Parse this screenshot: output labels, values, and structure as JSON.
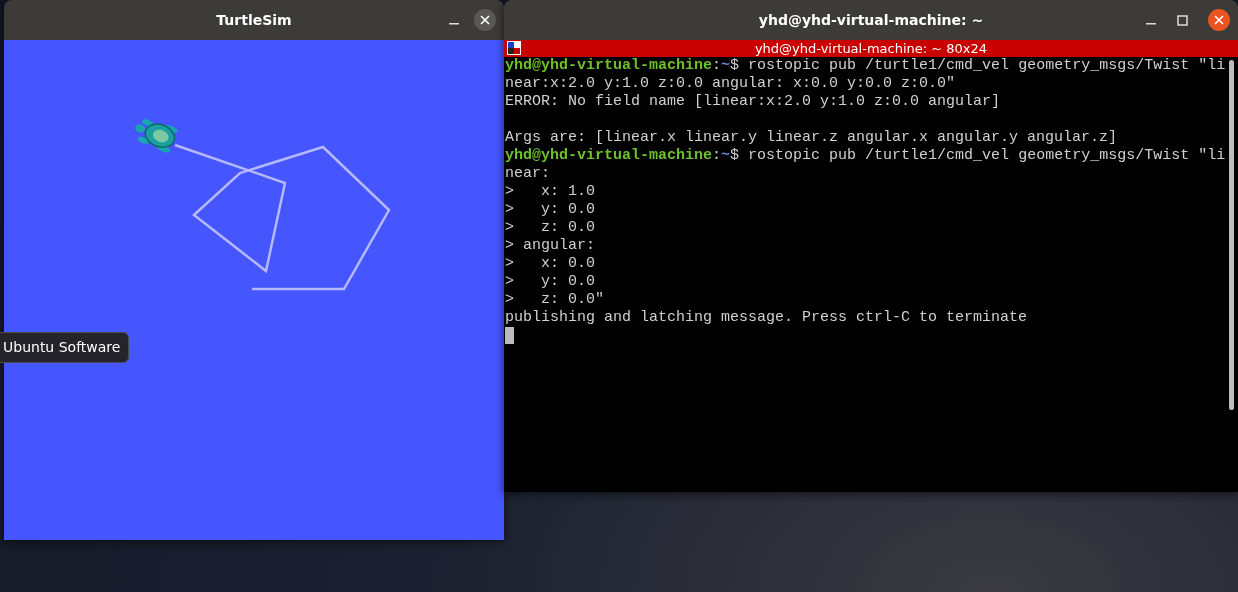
{
  "turtlesim": {
    "title": "TurtleSim"
  },
  "terminal": {
    "title": "yhd@yhd-virtual-machine: ~",
    "tab_title": "yhd@yhd-virtual-machine: ~ 80x24",
    "lines": [
      {
        "kind": "prompt",
        "user": "yhd@yhd-virtual-machine",
        "sep": ":",
        "path": "~",
        "command": "$ rostopic pub /turtle1/cmd_vel geometry_msgs/Twist \"li"
      },
      {
        "kind": "output",
        "text": "near:x:2.0 y:1.0 z:0.0 angular: x:0.0 y:0.0 z:0.0\""
      },
      {
        "kind": "output",
        "text": "ERROR: No field name [linear:x:2.0 y:1.0 z:0.0 angular]"
      },
      {
        "kind": "blank"
      },
      {
        "kind": "output",
        "text": "Args are: [linear.x linear.y linear.z angular.x angular.y angular.z]"
      },
      {
        "kind": "prompt",
        "user": "yhd@yhd-virtual-machine",
        "sep": ":",
        "path": "~",
        "command": "$ rostopic pub /turtle1/cmd_vel geometry_msgs/Twist \"li"
      },
      {
        "kind": "output",
        "text": "near:"
      },
      {
        "kind": "output",
        "text": ">   x: 1.0"
      },
      {
        "kind": "output",
        "text": ">   y: 0.0"
      },
      {
        "kind": "output",
        "text": ">   z: 0.0"
      },
      {
        "kind": "output",
        "text": "> angular:"
      },
      {
        "kind": "output",
        "text": ">   x: 0.0"
      },
      {
        "kind": "output",
        "text": ">   y: 0.0"
      },
      {
        "kind": "output",
        "text": ">   z: 0.0\""
      },
      {
        "kind": "output",
        "text": "publishing and latching message. Press ctrl-C to terminate"
      },
      {
        "kind": "cursor"
      }
    ]
  },
  "tooltip": {
    "text": "Ubuntu Software"
  }
}
